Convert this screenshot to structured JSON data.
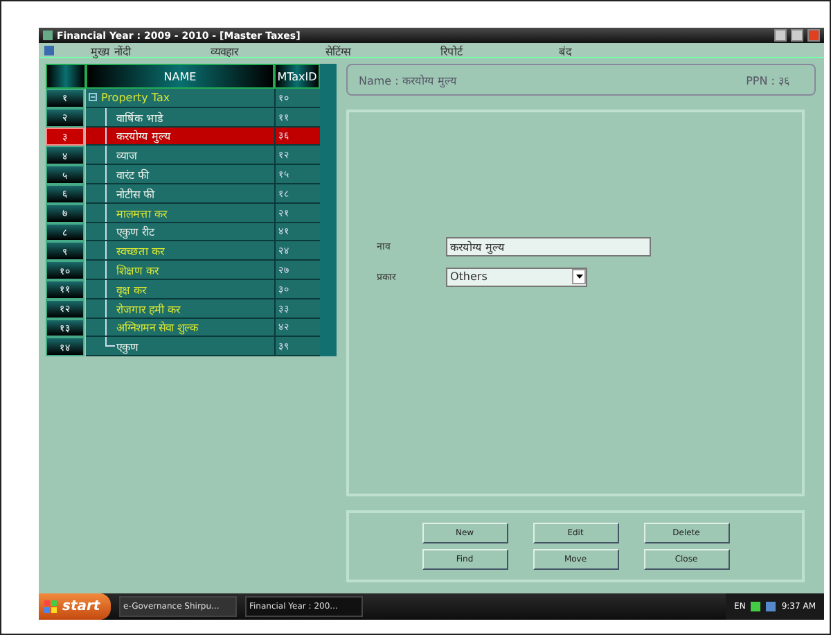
{
  "window": {
    "title": "Financial Year :  2009 - 2010  - [Master Taxes]"
  },
  "menu": [
    "मुख्य नोंदी",
    "व्यवहार",
    "सेटिंग्स",
    "रिपोर्ट",
    "बंद"
  ],
  "grid": {
    "columns": [
      "NAME",
      "MTaxID"
    ],
    "rows": [
      {
        "serial": "१",
        "name": "Property Tax",
        "id": "१०",
        "expanded": true,
        "selected": false,
        "highlighted": true,
        "children": [
          {
            "serial": "२",
            "name": "वार्षिक भाडे",
            "id": "११",
            "selected": false,
            "highlighted": false
          },
          {
            "serial": "३",
            "name": "करयोग्य मुल्य",
            "id": "३६",
            "selected": true,
            "highlighted": false
          },
          {
            "serial": "४",
            "name": "व्याज",
            "id": "१२",
            "selected": false,
            "highlighted": false
          },
          {
            "serial": "५",
            "name": "वारंट फी",
            "id": "१५",
            "selected": false,
            "highlighted": false
          },
          {
            "serial": "६",
            "name": "नोटीस फी",
            "id": "१८",
            "selected": false,
            "highlighted": false
          },
          {
            "serial": "७",
            "name": "मालमत्ता कर",
            "id": "२१",
            "selected": false,
            "highlighted": true
          },
          {
            "serial": "८",
            "name": "एकुण रीट",
            "id": "४१",
            "selected": false,
            "highlighted": false
          },
          {
            "serial": "९",
            "name": "स्वच्छता कर",
            "id": "२४",
            "selected": false,
            "highlighted": true
          },
          {
            "serial": "१०",
            "name": "शिक्षण कर",
            "id": "२७",
            "selected": false,
            "highlighted": true
          },
          {
            "serial": "११",
            "name": "वृक्ष कर",
            "id": "३०",
            "selected": false,
            "highlighted": true
          },
          {
            "serial": "१२",
            "name": "रोजगार हमी कर",
            "id": "३३",
            "selected": false,
            "highlighted": true
          },
          {
            "serial": "१३",
            "name": "अग्निशमन सेवा शुल्क",
            "id": "४२",
            "selected": false,
            "highlighted": true
          },
          {
            "serial": "१४",
            "name": "एकुण",
            "id": "३९",
            "selected": false,
            "highlighted": false
          }
        ]
      }
    ]
  },
  "header": {
    "name": "Name : करयोग्य मुल्य",
    "ppn": "PPN : ३६"
  },
  "fields": [
    {
      "kind": "text",
      "label": "नाव",
      "value": "करयोग्य मुल्य"
    },
    {
      "kind": "select",
      "label": "प्रकार",
      "value": "Others"
    }
  ],
  "buttons": [
    [
      "New",
      "Edit",
      "Delete"
    ],
    [
      "Find",
      "Move",
      "Close"
    ]
  ],
  "taskbar": {
    "start": "start",
    "tasks": [
      "e-Governance Shirpu...",
      "Financial Year :   200..."
    ],
    "language": "EN",
    "time": "9:37 AM"
  }
}
